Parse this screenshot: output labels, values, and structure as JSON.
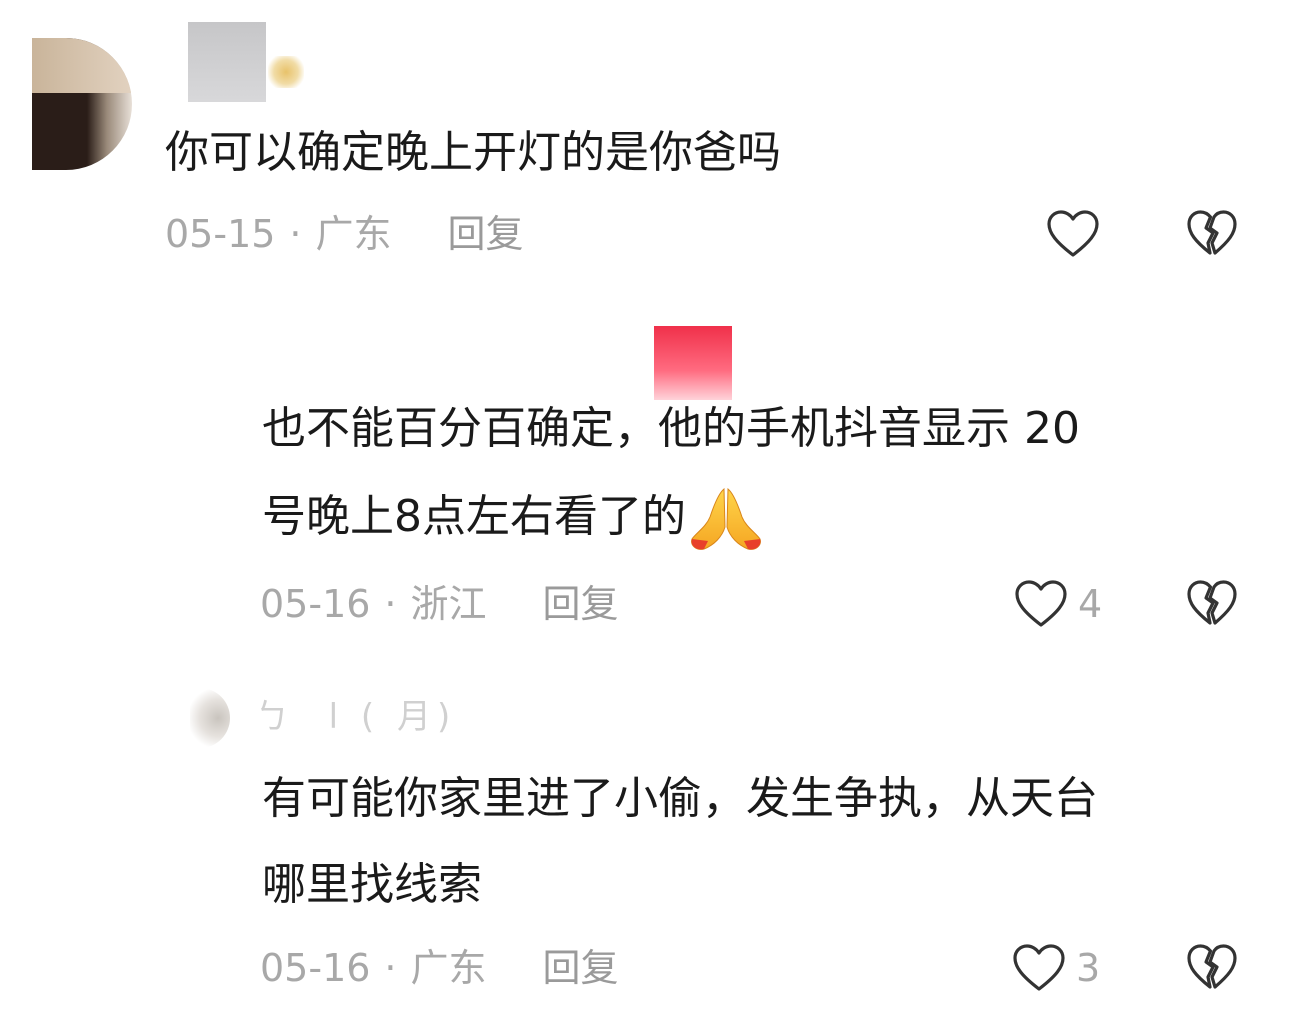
{
  "comments": [
    {
      "text": "你可以确定晚上开灯的是你爸吗",
      "date": "05-15",
      "location": "广东",
      "reply_label": "回复",
      "like_count": ""
    },
    {
      "text_line1": "也不能百分百确定，他的手机抖音显示 20",
      "text_line2": "号晚上8点左右看了的",
      "emoji": "🙏",
      "date": "05-16",
      "location": "浙江",
      "reply_label": "回复",
      "like_count": "4"
    },
    {
      "author_fragment": "ㄅ          ‌ l                         (          月)",
      "text_line1": "有可能你家里进了小偷，发生争执，从天台",
      "text_line2": "哪里找线索",
      "date": "05-16",
      "location": "广东",
      "reply_label": "回复",
      "like_count": "3"
    }
  ],
  "separator_dot": "·",
  "icons": {
    "like": "heart-outline-icon",
    "dislike": "broken-heart-icon",
    "emoji": "pray-hands-icon"
  },
  "colors": {
    "text": "#1a1a1a",
    "meta": "#a8a8a8",
    "icon_stroke": "#333333"
  }
}
